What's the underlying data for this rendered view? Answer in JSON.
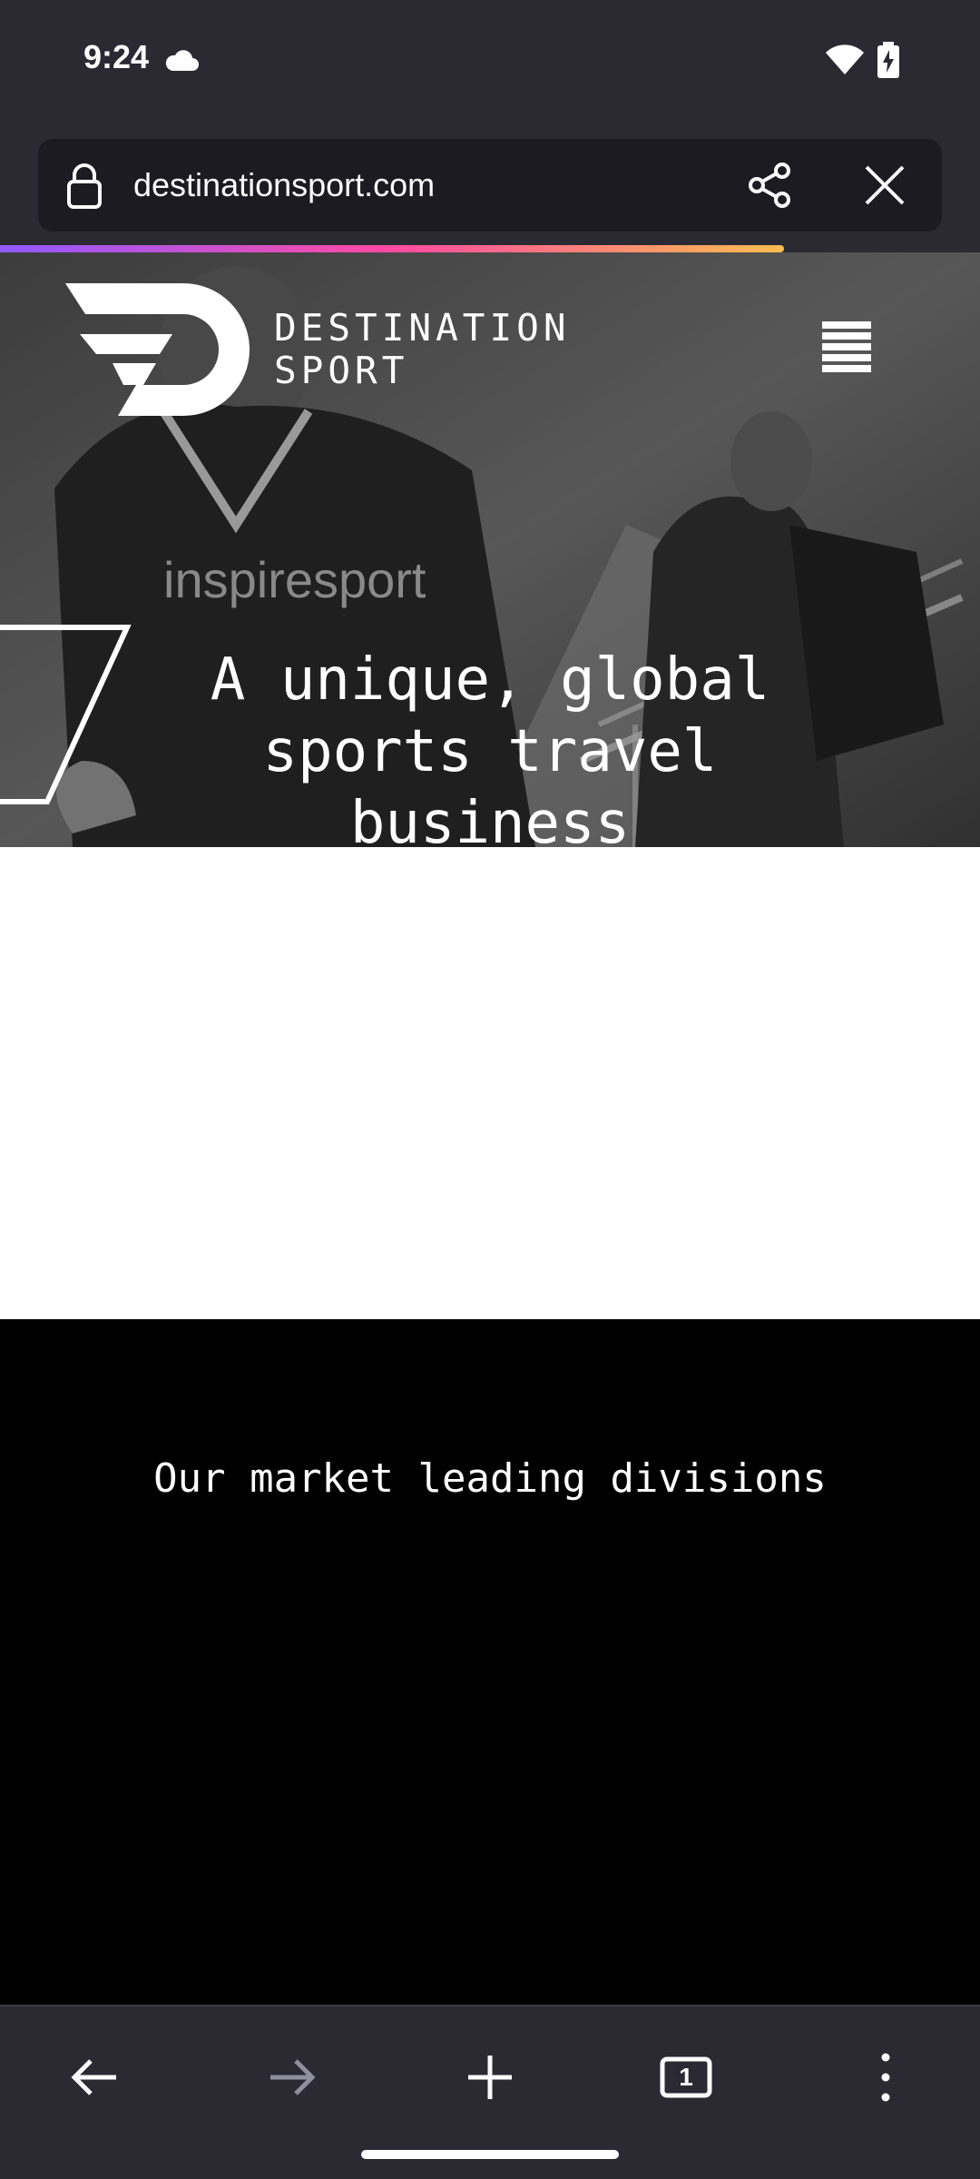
{
  "status_bar": {
    "time": "9:24",
    "icons": [
      "cloud-icon",
      "wifi-icon",
      "battery-charging-icon"
    ]
  },
  "toolbar": {
    "url": "destinationsport.com",
    "icons": [
      "lock-icon",
      "share-icon",
      "close-icon"
    ]
  },
  "progress": {
    "value": 0.8,
    "gradient": [
      "#9059ff",
      "#ff4aa2",
      "#ffbd4f"
    ]
  },
  "page": {
    "logo": {
      "line1": "DESTINATION",
      "line2": "SPORT"
    },
    "hero": {
      "headline": "A unique, global sports travel business",
      "photo_text": "inspiresport"
    },
    "divisions_title": "Our market leading divisions"
  },
  "bottom_nav": {
    "tab_count": "1",
    "icons": [
      "back-arrow-icon",
      "forward-arrow-icon",
      "plus-icon",
      "tabs-icon",
      "more-vert-icon"
    ]
  },
  "colors": {
    "chrome_bg": "#2b2a33",
    "url_field_bg": "#1c1b22",
    "text_light": "#fbfbfe",
    "hero_bg": "#3a3a3a",
    "content_black": "#000000",
    "content_white": "#ffffff"
  }
}
